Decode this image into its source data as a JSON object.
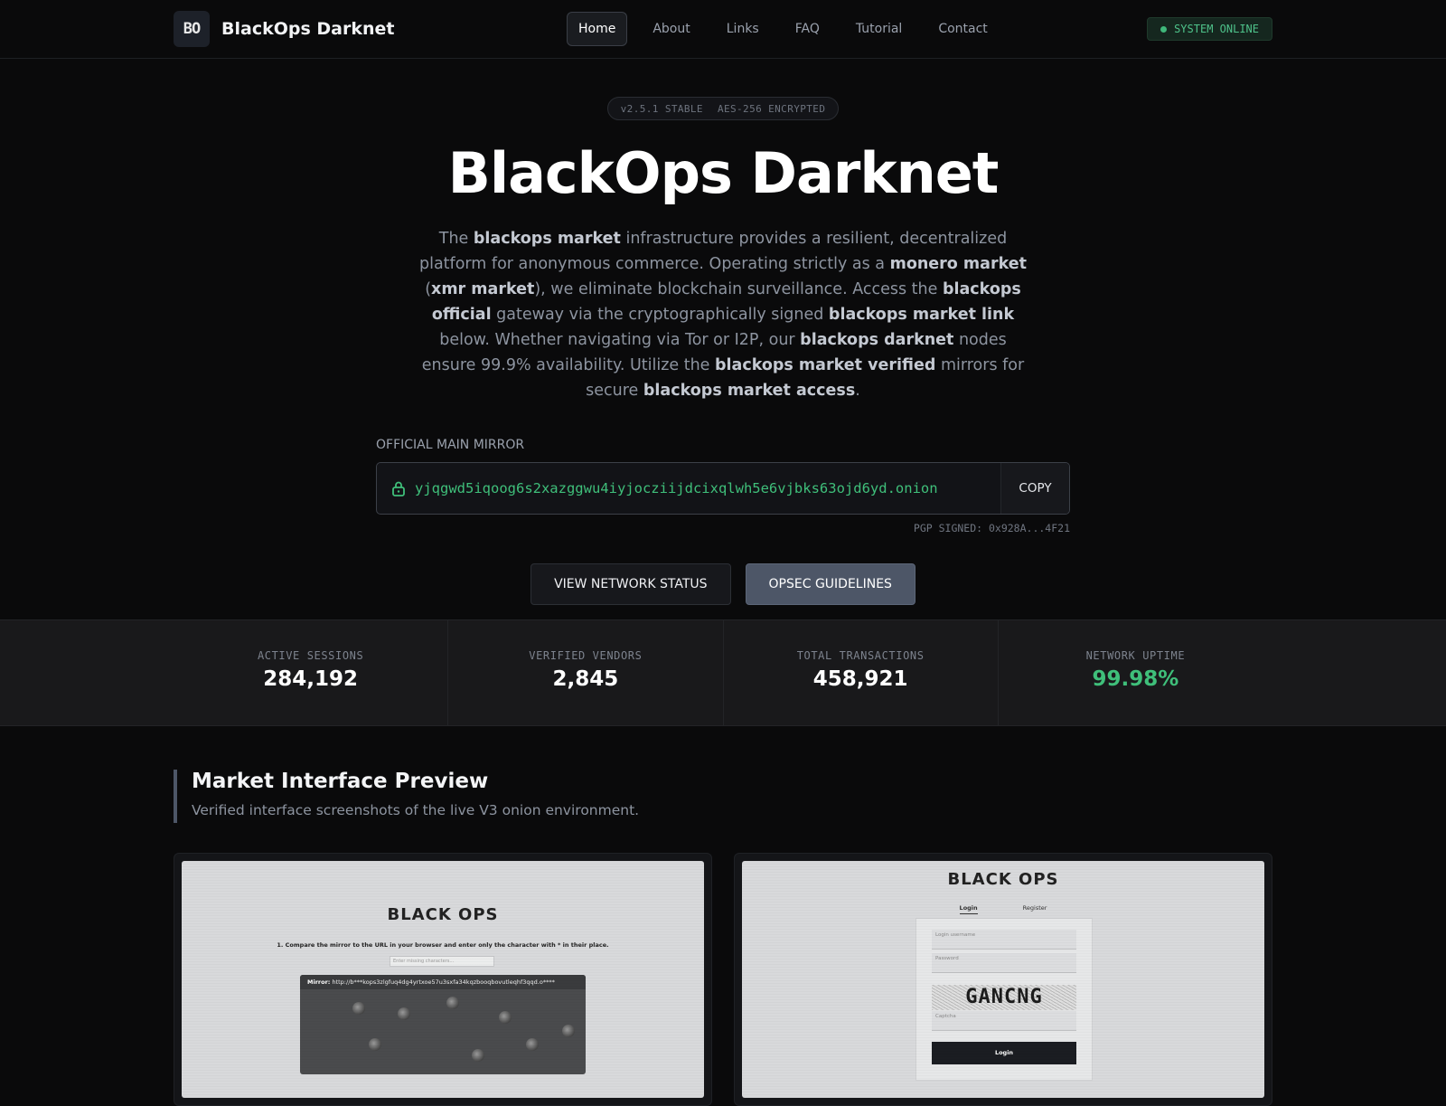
{
  "nav": {
    "logo_text": "BO",
    "brand": "BlackOps Darknet",
    "items": [
      "Home",
      "About",
      "Links",
      "FAQ",
      "Tutorial",
      "Contact"
    ],
    "status": "SYSTEM ONLINE"
  },
  "hero": {
    "version": "v2.5.1 STABLE",
    "encryption": "AES-256 ENCRYPTED",
    "title": "BlackOps Darknet",
    "desc": [
      {
        "t": "The ",
        "b": false
      },
      {
        "t": "blackops market",
        "b": true
      },
      {
        "t": " infrastructure provides a resilient, decentralized platform for anonymous commerce. Operating strictly as a ",
        "b": false
      },
      {
        "t": "monero market",
        "b": true
      },
      {
        "t": " (",
        "b": false
      },
      {
        "t": "xmr market",
        "b": true
      },
      {
        "t": "), we eliminate blockchain surveillance. Access the ",
        "b": false
      },
      {
        "t": "blackops official",
        "b": true
      },
      {
        "t": " gateway via the cryptographically signed ",
        "b": false
      },
      {
        "t": "blackops market link",
        "b": true
      },
      {
        "t": " below. Whether navigating via Tor or I2P, our ",
        "b": false
      },
      {
        "t": "blackops darknet",
        "b": true
      },
      {
        "t": " nodes ensure 99.9% availability. Utilize the ",
        "b": false
      },
      {
        "t": "blackops market verified",
        "b": true
      },
      {
        "t": " mirrors for secure ",
        "b": false
      },
      {
        "t": "blackops market access",
        "b": true
      },
      {
        "t": ".",
        "b": false
      }
    ]
  },
  "mirror": {
    "label": "OFFICIAL MAIN MIRROR",
    "url": "yjqgwd5iqoog6s2xazggwu4iyjocziijdcixqlwh5e6vjbks63ojd6yd.onion",
    "copy_label": "COPY",
    "pgp": "PGP SIGNED: 0x928A...4F21"
  },
  "cta": {
    "network_status": "VIEW NETWORK STATUS",
    "opsec": "OPSEC GUIDELINES"
  },
  "stats": [
    {
      "label": "ACTIVE SESSIONS",
      "value": "284,192"
    },
    {
      "label": "VERIFIED VENDORS",
      "value": "2,845"
    },
    {
      "label": "TOTAL TRANSACTIONS",
      "value": "458,921"
    },
    {
      "label": "NETWORK UPTIME",
      "value": "99.98%"
    }
  ],
  "preview": {
    "title": "Market Interface Preview",
    "subtitle": "Verified interface screenshots of the live V3 onion environment.",
    "shot1": {
      "logo": "BLACK OPS",
      "instruction": "1. Compare the mirror to the URL in your browser and enter only the character with * in their place.",
      "input_placeholder": "Enter missing characters...",
      "mirror_label": "Mirror:",
      "mirror_url": "http://b***kops3zlgfuq4dg4yrtxoe57u3sxfa34kqzbooqbovutleqhf3qqd.o****"
    },
    "shot2": {
      "logo": "BLACK OPS",
      "tab_login": "Login",
      "tab_register": "Register",
      "username_placeholder": "Login username",
      "password_placeholder": "Password",
      "captcha_text": "GANCNG",
      "captcha_placeholder": "Captcha",
      "login_button": "Login"
    }
  },
  "colors": {
    "accent_green": "#3fbf7a",
    "slate_button": "#4d5667"
  }
}
